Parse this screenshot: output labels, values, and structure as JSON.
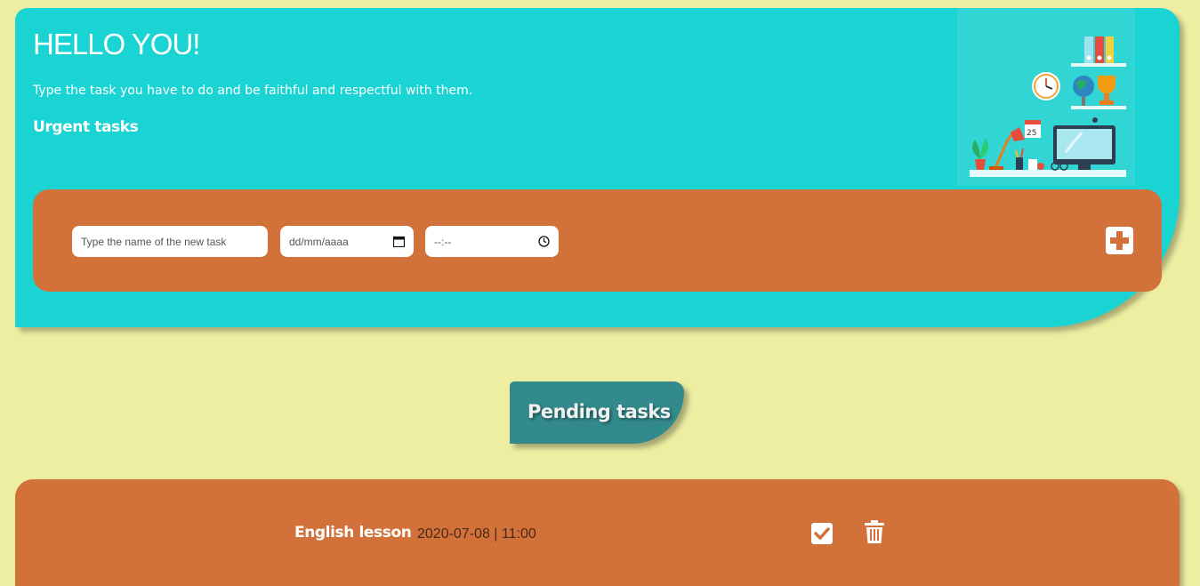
{
  "header": {
    "title": "HELLO YOU!",
    "subtitle": "Type the task you have to do and be faithful and respectful with them.",
    "urgent_label": "Urgent tasks"
  },
  "form": {
    "task_name_placeholder": "Type the name of the new task",
    "date_placeholder": "dd/mm/aaaa",
    "time_placeholder": "--:--",
    "add_icon": "plus-icon"
  },
  "illustration": {
    "calendar_day": "25"
  },
  "pending": {
    "label": "Pending tasks",
    "tasks": [
      {
        "name": "English lesson",
        "when": "2020-07-08 | 11:00"
      }
    ]
  },
  "colors": {
    "page_bg": "#eeeea2",
    "hero_bg": "#1ad3d3",
    "accent_orange": "#d2723a",
    "pending_tab": "#338a8c"
  }
}
